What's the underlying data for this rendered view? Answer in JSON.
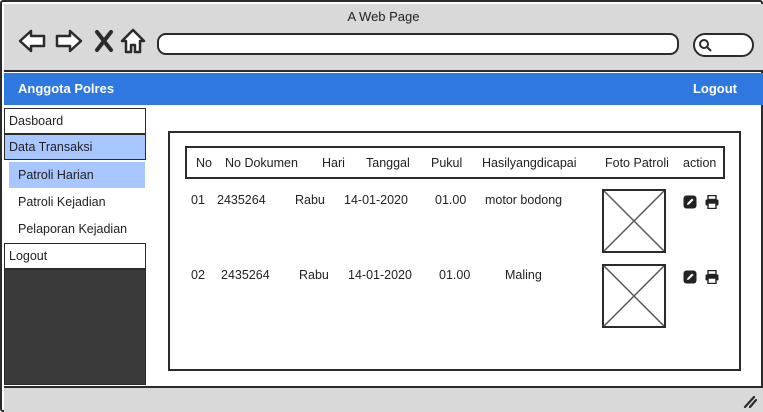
{
  "window": {
    "title": "A Web Page"
  },
  "topbar": {
    "brand": "Anggota Polres",
    "logout_label": "Logout"
  },
  "sidebar": {
    "items": [
      {
        "label": "Dasboard"
      },
      {
        "label": "Data Transaksi"
      },
      {
        "label": "Patroli Harian"
      },
      {
        "label": "Patroli Kejadian"
      },
      {
        "label": "Pelaporan Kejadian"
      },
      {
        "label": "Logout"
      }
    ]
  },
  "table": {
    "columns": [
      "No",
      "No Dokumen",
      "Hari",
      "Tanggal",
      "Pukul",
      "Hasilyangdicapai",
      "Foto Patroli",
      "action"
    ],
    "rows": [
      {
        "no": "01",
        "doc": "2435264",
        "hari": "Rabu",
        "tanggal": "14-01-2020",
        "pukul": "01.00",
        "hasil": "motor bodong"
      },
      {
        "no": "02",
        "doc": "2435264",
        "hari": "Rabu",
        "tanggal": "14-01-2020",
        "pukul": "01.00",
        "hasil": "Maling"
      }
    ]
  },
  "icons": {
    "back": "arrow-left-icon",
    "forward": "arrow-right-icon",
    "stop": "close-icon",
    "home": "home-icon",
    "search": "search-icon",
    "edit": "edit-icon",
    "print": "print-icon",
    "image_placeholder": "image-placeholder-icon"
  },
  "colors": {
    "accent": "#2f78e0",
    "active_menu": "#a8c6ff",
    "chrome": "#d9d9d9",
    "sidebar_dark": "#3a3a3a"
  }
}
